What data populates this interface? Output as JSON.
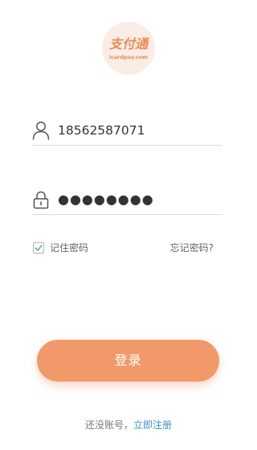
{
  "logo": {
    "name": "支付通",
    "domain": "icardpay.com",
    "color": "#ee8a55"
  },
  "form": {
    "username": {
      "icon": "user-icon",
      "value": "18562587071"
    },
    "password": {
      "icon": "lock-icon",
      "value": "●●●●●●●●"
    },
    "remember": {
      "label": "记住密码",
      "checked": true
    },
    "forgot_label": "忘记密码?"
  },
  "login_button": {
    "label": "登录",
    "color": "#f2996a"
  },
  "footer": {
    "prompt": "还没账号，",
    "register_label": "立即注册",
    "link_color": "#3f8fd0"
  }
}
